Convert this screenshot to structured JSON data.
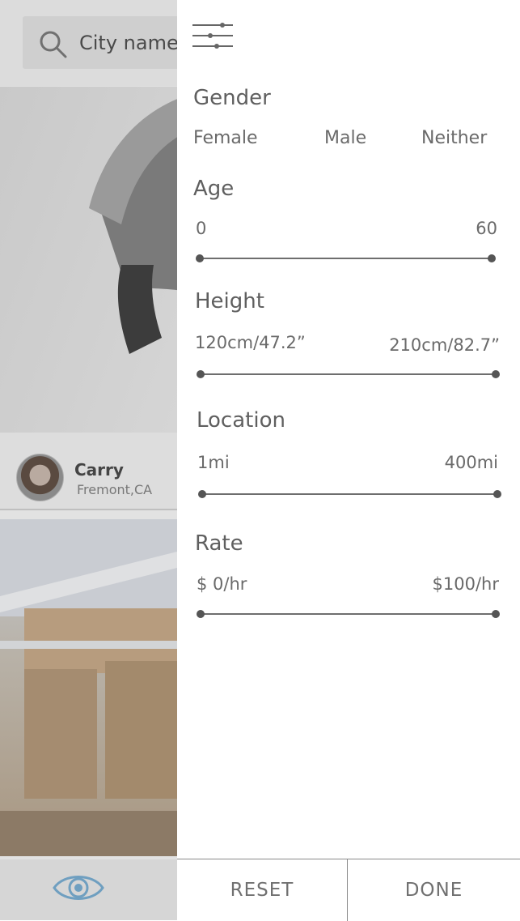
{
  "background": {
    "search": {
      "placeholder": "City name, or Zip"
    },
    "profile": {
      "name": "Carry",
      "location": "Fremont,CA"
    }
  },
  "drawer": {
    "gender": {
      "title": "Gender",
      "options": [
        "Female",
        "Male",
        "Neither"
      ]
    },
    "age": {
      "title": "Age",
      "min": "0",
      "max": "60"
    },
    "height": {
      "title": "Height",
      "min": "120cm/47.2”",
      "max": "210cm/82.7”"
    },
    "location": {
      "title": "Location",
      "min": "1mi",
      "max": "400mi"
    },
    "rate": {
      "title": "Rate",
      "min": "$ 0/hr",
      "max": "$100/hr"
    },
    "footer": {
      "reset_label": "RESET",
      "done_label": "DONE"
    }
  },
  "icons": {
    "filter": "sliders-icon",
    "search": "search-icon",
    "eye": "eye-icon"
  },
  "colors": {
    "accent_eye": "#6f9fc0",
    "text": "#5a5a5a"
  }
}
